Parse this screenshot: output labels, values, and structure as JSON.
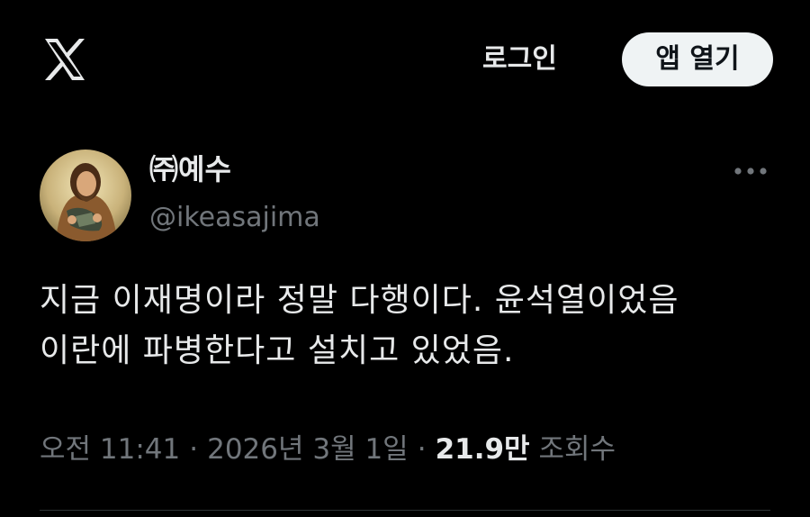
{
  "header": {
    "logo_icon": "x-logo-icon",
    "login_label": "로그인",
    "open_app_label": "앱 열기"
  },
  "tweet": {
    "author": {
      "display_name": "㈜예수",
      "handle": "@ikeasajima",
      "avatar": "avatar-image"
    },
    "more_icon": "more-icon",
    "text_lines": [
      "지금 이재명이라 정말 다행이다. 윤석열이었음",
      "이란에 파병한다고 설치고 있었음."
    ],
    "time": "오전 11:41",
    "separator": "·",
    "date": "2026년 3월 1일",
    "views_count": "21.9만",
    "views_label": "조회수"
  },
  "colors": {
    "background": "#000000",
    "text_primary": "#e7e9ea",
    "text_secondary": "#71767b",
    "button_bg": "#eff3f4",
    "button_text": "#0f1419",
    "divider": "#2f3336"
  }
}
